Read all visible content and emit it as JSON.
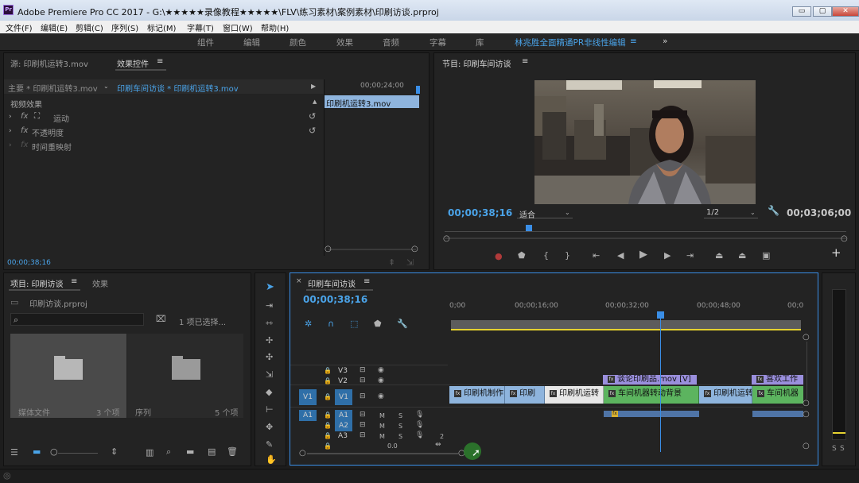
{
  "titlebar": {
    "app_icon": "Pr",
    "title": "Adobe Premiere Pro CC 2017 - G:\\★★★★★录像教程★★★★★\\FLV\\练习素材\\案例素材\\印刷访谈.prproj",
    "minimize": "▭",
    "maximize": "▢",
    "close": "✕"
  },
  "menu": [
    "文件(F)",
    "编辑(E)",
    "剪辑(C)",
    "序列(S)",
    "标记(M)",
    "字幕(T)",
    "窗口(W)",
    "帮助(H)"
  ],
  "workspaces": [
    "组件",
    "编辑",
    "颜色",
    "效果",
    "音频",
    "字幕",
    "库"
  ],
  "workspace_active": "林兆胜全面精通PR非线性编辑",
  "workspace_menu": "≡",
  "workspace_more": "»",
  "source_panel": {
    "tab_source": "源: 印刷机运转3.mov",
    "tab_effects": "效果控件",
    "tab_menu": "≡",
    "master_label": "主要 * 印刷机运转3.mov",
    "sequence_label": "印刷车间访谈 * 印刷机运转3.mov",
    "ruler_timecode": "00;00;24;00",
    "clip_name": "印刷机运转3.mov",
    "section_title": "视频效果",
    "rows": [
      "运动",
      "不透明度",
      "时间重映射"
    ],
    "fx_icon": "fx",
    "timecode": "00;00;38;16"
  },
  "program_monitor": {
    "tab": "节目: 印刷车间访谈",
    "tab_menu": "≡",
    "timecode": "00;00;38;16",
    "fit": "适合",
    "resolution": "1/2",
    "duration": "00;03;06;00",
    "playhead_fraction": 0.21
  },
  "project_panel": {
    "tab_project": "项目: 印刷访谈",
    "tab_menu": "≡",
    "tab_effects": "效果",
    "project_file": "印刷访谈.prproj",
    "selection": "1 项已选择...",
    "bins": [
      {
        "name": "媒体文件",
        "count": "3 个项"
      },
      {
        "name": "序列",
        "count": "5 个项"
      }
    ]
  },
  "timeline": {
    "tab": "印刷车间访谈",
    "tab_menu": "≡",
    "timecode": "00;00;38;16",
    "ruler": [
      "0;00",
      "00;00;16;00",
      "00;00;32;00",
      "00;00;48;00",
      "00;0"
    ],
    "tracks": {
      "v3": "V3",
      "v2": "V2",
      "v1_source": "V1",
      "v1": "V1",
      "a1_source": "A1",
      "a1": "A1",
      "a2": "A2",
      "a3": "A3",
      "mute": "M",
      "solo": "S",
      "a3_extra": "2"
    },
    "master_level": "0.0",
    "clips_v1": [
      "印刷机制作",
      "印刷",
      "印刷机运转",
      "车间机器转动背景",
      "印刷机运转",
      "车间机器"
    ],
    "clips_v3": [
      "谈论印刷品.mov [V]",
      "喜欢工作"
    ],
    "fx_badge": "fx"
  },
  "meter": {
    "labels": [
      "S",
      "S"
    ]
  },
  "colors": {
    "accent_blue": "#4aa3e8",
    "clip_video": "#8eb4dd",
    "clip_green": "#5cb45f",
    "clip_v3": "#9a8fdd",
    "playhead": "#3a8ee6"
  }
}
